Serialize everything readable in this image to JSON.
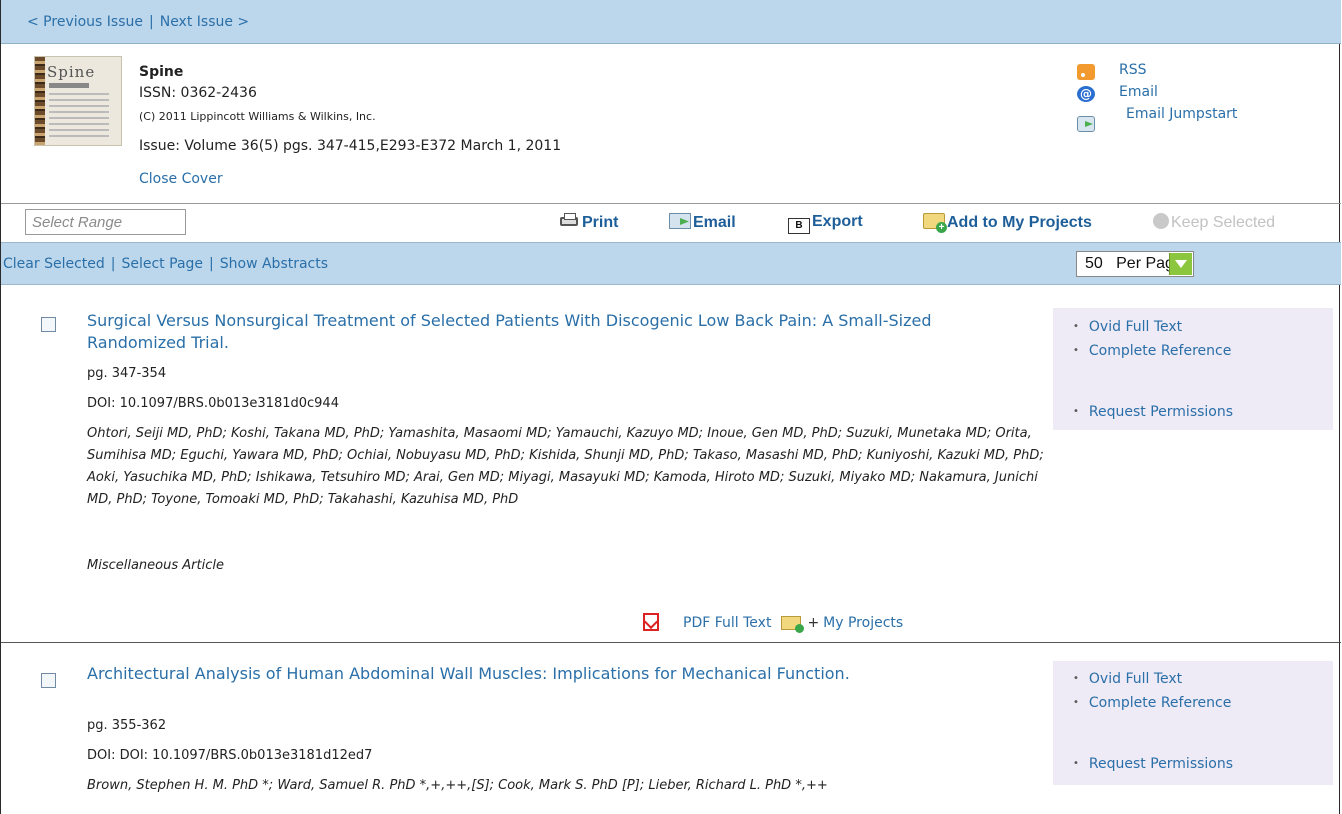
{
  "nav": {
    "previous": "< Previous Issue",
    "separator": "|",
    "next": "Next Issue >"
  },
  "journal": {
    "cover_title": "Spine",
    "name": "Spine",
    "issn": "ISSN: 0362-2436",
    "copyright": "(C) 2011 Lippincott Williams & Wilkins, Inc.",
    "issue": "Issue: Volume 36(5) pgs. 347-415,E293-E372 March 1, 2011",
    "close_cover": "Close Cover"
  },
  "feeds": {
    "rss": "RSS",
    "email": "Email",
    "email_jumpstart": "Email Jumpstart"
  },
  "toolbar": {
    "select_range_placeholder": "Select Range",
    "print": "Print",
    "email": "Email",
    "export": "Export",
    "export_icon": "B",
    "add_projects": "Add to My Projects",
    "keep_selected": "Keep Selected"
  },
  "selection": {
    "clear": "Clear Selected",
    "select_page": "Select Page",
    "show_abstracts": "Show Abstracts",
    "separator": "|",
    "per_page": "50   Per Page"
  },
  "articles": [
    {
      "title": "Surgical Versus Nonsurgical Treatment of Selected Patients With Discogenic Low Back Pain: A Small-Sized Randomized Trial.",
      "pages": "pg. 347-354",
      "doi": "DOI: 10.1097/BRS.0b013e3181d0c944",
      "authors": "Ohtori, Seiji MD, PhD; Koshi, Takana MD, PhD; Yamashita, Masaomi MD; Yamauchi, Kazuyo MD; Inoue, Gen MD, PhD; Suzuki, Munetaka MD; Orita, Sumihisa MD; Eguchi, Yawara MD, PhD; Ochiai, Nobuyasu MD, PhD; Kishida, Shunji MD, PhD; Takaso, Masashi MD, PhD; Kuniyoshi, Kazuki MD, PhD; Aoki, Yasuchika MD, PhD; Ishikawa, Tetsuhiro MD; Arai, Gen MD; Miyagi, Masayuki MD; Kamoda, Hiroto MD; Suzuki, Miyako MD; Nakamura, Junichi MD, PhD; Toyone, Tomoaki MD, PhD; Takahashi, Kazuhisa MD, PhD",
      "type": "Miscellaneous Article",
      "pdf": "PDF Full Text",
      "plus": "+",
      "my_projects": "My Projects",
      "links": {
        "ovid": "Ovid Full Text",
        "complete": "Complete Reference",
        "permissions": "Request Permissions"
      }
    },
    {
      "title": "Architectural Analysis of Human Abdominal Wall Muscles: Implications for Mechanical Function.",
      "pages": "pg. 355-362",
      "doi": "DOI: DOI: 10.1097/BRS.0b013e3181d12ed7",
      "authors": "Brown, Stephen H. M. PhD *; Ward, Samuel R. PhD *,+,++,[S]; Cook, Mark S. PhD [P]; Lieber, Richard L. PhD *,++",
      "links": {
        "ovid": "Ovid Full Text",
        "complete": "Complete Reference",
        "permissions": "Request Permissions"
      }
    }
  ],
  "colors": {
    "bar": "#bcd7ec",
    "link": "#2a6fa8",
    "sidebox": "#eeeaf6",
    "toolbar_link": "#1f5f99"
  }
}
